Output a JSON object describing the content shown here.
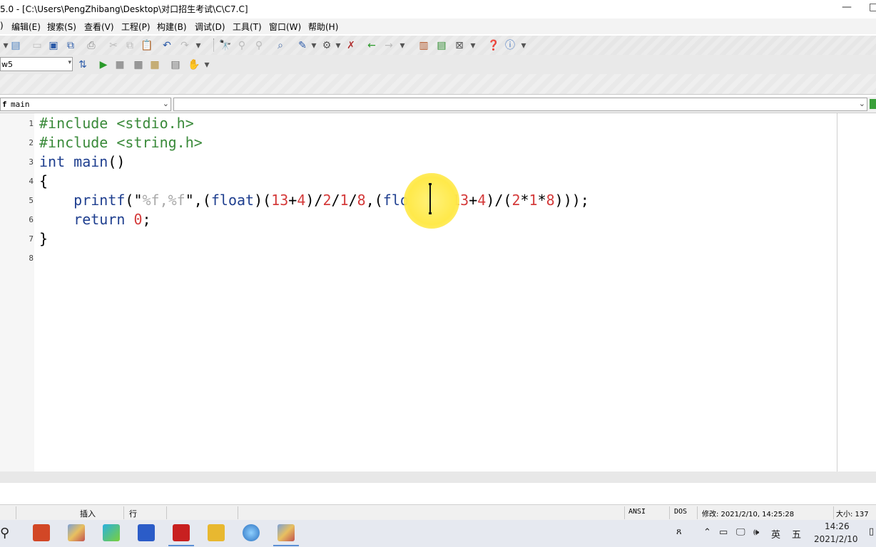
{
  "window": {
    "title": "5.0 - [C:\\Users\\PengZhibang\\Desktop\\对口招生考试\\C\\C7.C]",
    "controls": [
      "—",
      "□"
    ]
  },
  "menu": [
    "编辑(E)",
    "搜索(S)",
    "查看(V)",
    "工程(P)",
    "构建(B)",
    "调试(D)",
    "工具(T)",
    "窗口(W)",
    "帮助(H)"
  ],
  "toolbar": {
    "config_combo": "w5"
  },
  "function_bar": {
    "scope_prefix": "f",
    "function": "main",
    "symbol": ""
  },
  "editor": {
    "line_numbers": [
      "1",
      "2",
      "3",
      "4",
      "5",
      "6",
      "7",
      "8"
    ],
    "lines": [
      [
        {
          "t": "#include <stdio.h>",
          "c": "pp"
        }
      ],
      [
        {
          "t": "#include <string.h>",
          "c": "pp"
        }
      ],
      [
        {
          "t": "int main",
          "c": "kw"
        },
        {
          "t": "()",
          "c": "plain"
        }
      ],
      [
        {
          "t": "{",
          "c": "plain"
        }
      ],
      [
        {
          "t": "    printf",
          "c": "kw"
        },
        {
          "t": "(\"",
          "c": "plain"
        },
        {
          "t": "%f,%f",
          "c": "str"
        },
        {
          "t": "\",(",
          "c": "plain"
        },
        {
          "t": "float",
          "c": "kw"
        },
        {
          "t": ")(",
          "c": "plain"
        },
        {
          "t": "13",
          "c": "num"
        },
        {
          "t": "+",
          "c": "plain"
        },
        {
          "t": "4",
          "c": "num"
        },
        {
          "t": ")/",
          "c": "plain"
        },
        {
          "t": "2",
          "c": "num"
        },
        {
          "t": "/",
          "c": "plain"
        },
        {
          "t": "1",
          "c": "num"
        },
        {
          "t": "/",
          "c": "plain"
        },
        {
          "t": "8",
          "c": "num"
        },
        {
          "t": ",(",
          "c": "plain"
        },
        {
          "t": "float",
          "c": "kw"
        },
        {
          "t": ")((",
          "c": "plain"
        },
        {
          "t": "13",
          "c": "num"
        },
        {
          "t": "+",
          "c": "plain"
        },
        {
          "t": "4",
          "c": "num"
        },
        {
          "t": ")/(",
          "c": "plain"
        },
        {
          "t": "2",
          "c": "num"
        },
        {
          "t": "*",
          "c": "plain"
        },
        {
          "t": "1",
          "c": "num"
        },
        {
          "t": "*",
          "c": "plain"
        },
        {
          "t": "8",
          "c": "num"
        },
        {
          "t": ")));",
          "c": "plain"
        }
      ],
      [
        {
          "t": "    return ",
          "c": "kw"
        },
        {
          "t": "0",
          "c": "num"
        },
        {
          "t": ";",
          "c": "plain"
        }
      ],
      [
        {
          "t": "}",
          "c": "plain"
        }
      ],
      []
    ]
  },
  "status": {
    "insert": "插入",
    "row": "行",
    "encoding": "ANSI",
    "line_end": "DOS",
    "modified": "修改: 2021/2/10, 14:25:28",
    "size": "大小: 137"
  },
  "taskbar": {
    "ime": "英",
    "ime2": "五",
    "time": "14:26",
    "date": "2021/2/10"
  }
}
